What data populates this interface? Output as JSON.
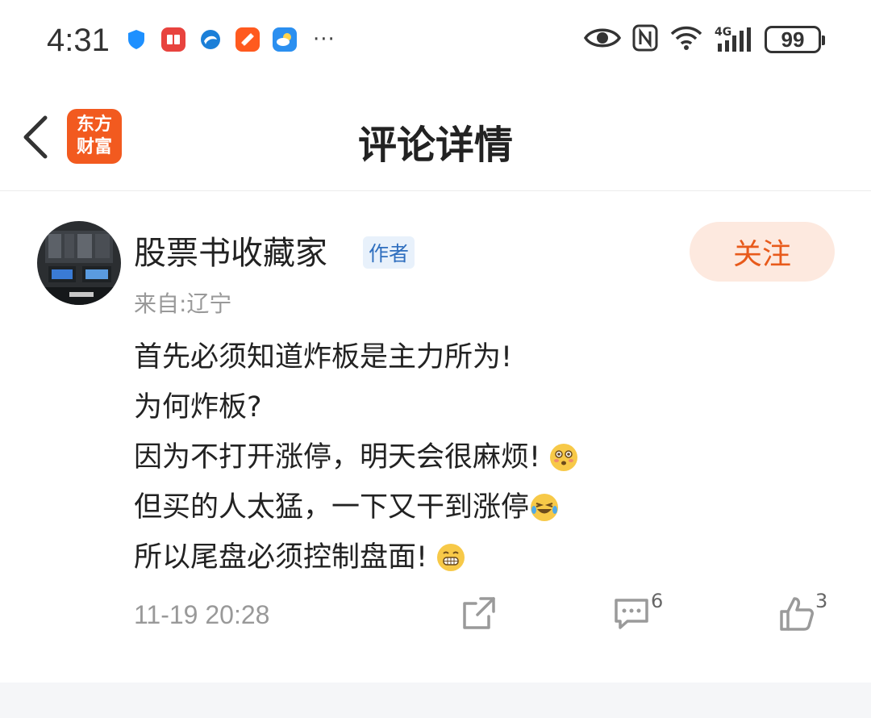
{
  "status_bar": {
    "time": "4:31",
    "app_icons": [
      "shield-icon",
      "book-icon",
      "browser-icon",
      "video-icon",
      "weather-icon"
    ],
    "more": "···",
    "battery": "99",
    "network": "4G"
  },
  "nav": {
    "title": "评论详情",
    "logo_line1": "东方",
    "logo_line2": "财富"
  },
  "comment": {
    "username": "股票书收藏家",
    "badge": "作者",
    "location": "来自:辽宁",
    "follow_label": "关注",
    "lines": [
      "首先必须知道炸板是主力所为!",
      "为何炸板?",
      "因为不打开涨停，明天会很麻烦!",
      "但买的人太猛，一下又干到涨停",
      "所以尾盘必须控制盘面!"
    ],
    "emojis": [
      "flushed-emoji",
      "laughing-tears-emoji",
      "grin-emoji"
    ],
    "timestamp": "11-19 20:28",
    "reply_count": "6",
    "like_count": "3"
  },
  "colors": {
    "accent": "#e85a1b",
    "follow_bg": "#fde9df",
    "badge_text": "#2f6fbf",
    "badge_bg": "#e8f1fb"
  }
}
